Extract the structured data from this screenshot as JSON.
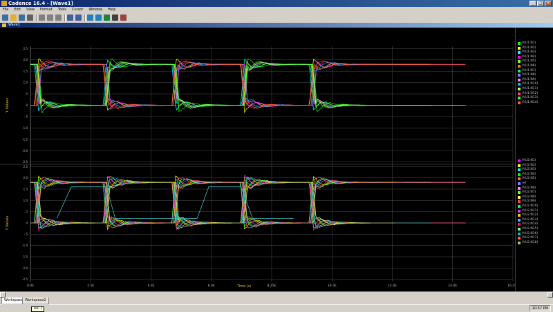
{
  "app": {
    "title": "Cadence 16.4 - [Wave1]"
  },
  "menu": [
    "File",
    "Edit",
    "View",
    "Format",
    "Tools",
    "Cursor",
    "Window",
    "Help"
  ],
  "child_window": {
    "title": "Wave1"
  },
  "tabs": [
    "Workspace1",
    "Workspace2"
  ],
  "status": {
    "tooltip": "Tab: 1",
    "time": "10:57 PM"
  },
  "colors": {
    "background": "#000000",
    "grid": "#505050"
  },
  "toolbar_icons": [
    "new-icon",
    "open-icon",
    "save-icon",
    "print-icon",
    "cut-icon",
    "copy-icon",
    "paste-icon",
    "undo-icon",
    "redo-icon",
    "zoom-in-icon",
    "zoom-out-icon",
    "fit-icon",
    "cursor-icon",
    "measure-icon"
  ],
  "chart_data": [
    {
      "type": "line",
      "title": "",
      "xlabel": "Time (s)",
      "ylabel": "Y Values",
      "xlim": [
        0,
        16.5
      ],
      "ylim": [
        -2.6,
        2.6
      ],
      "x_ticks": [
        "0.0E",
        "2.5E",
        "4.0E",
        "6.0E",
        "8.25E",
        "10.5E",
        "12.0E",
        "14.0E",
        "16.25E"
      ],
      "y_ticks": [
        "2.5",
        "2.0",
        "1.5",
        "1.0",
        ".5",
        "0",
        "-.5",
        "-1.0",
        "-1.5",
        "-2.0",
        "-2.5"
      ],
      "transitions": [
        0.2,
        2.55,
        4.9,
        7.25,
        9.6
      ],
      "levels": {
        "high": 1.8,
        "low": 0.0,
        "overshoot": 2.1,
        "undershoot": -0.3
      },
      "series_count": 14
    },
    {
      "type": "line",
      "title": "",
      "xlabel": "Time (s)",
      "ylabel": "Y Values",
      "xlim": [
        0,
        16.5
      ],
      "ylim": [
        -2.6,
        2.6
      ],
      "x_ticks": [
        "0.0E",
        "2.5E",
        "4.0E",
        "6.0E",
        "8.25E",
        "10.5E",
        "12.0E",
        "14.0E",
        "16.25E"
      ],
      "y_ticks": [
        "2.5",
        "2.0",
        "1.5",
        "1.0",
        ".5",
        "0",
        "-.5",
        "-1.0",
        "-1.5",
        "-2.0",
        "-2.5"
      ],
      "transitions": [
        0.2,
        2.55,
        4.9,
        7.25,
        9.6
      ],
      "levels": {
        "high": 1.8,
        "low": 0.0,
        "overshoot": 2.1,
        "undershoot": -0.3
      },
      "series_count": 19
    }
  ],
  "legend_top": [
    {
      "label": "V(U1.N1)",
      "color": "#00ff00"
    },
    {
      "label": "V(U1.N2)",
      "color": "#ffff00"
    },
    {
      "label": "V(U1.N3)",
      "color": "#00ffff"
    },
    {
      "label": "V(U1.N4)",
      "color": "#ff00ff"
    },
    {
      "label": "V(U1.N5)",
      "color": "#80ff00"
    },
    {
      "label": "V(U1.N6)",
      "color": "#ff8000"
    },
    {
      "label": "V(U1.N7)",
      "color": "#00ff80"
    },
    {
      "label": "V(U1.N8)",
      "color": "#8080ff"
    },
    {
      "label": "V(U1.N9)",
      "color": "#ff80ff"
    },
    {
      "label": "V(U1.N10)",
      "color": "#00c0ff"
    },
    {
      "label": "V(U1.N11)",
      "color": "#c0ff40"
    },
    {
      "label": "V(U1.N12)",
      "color": "#ff4080"
    },
    {
      "label": "V(U1.N13)",
      "color": "#40ff40"
    },
    {
      "label": "V(U1.N14)",
      "color": "#ff6020"
    }
  ],
  "legend_bottom": [
    {
      "label": "V(U2.N1)",
      "color": "#ff00ff"
    },
    {
      "label": "V(U2.N2)",
      "color": "#ffff00"
    },
    {
      "label": "V(U2.N3)",
      "color": "#00ffff"
    },
    {
      "label": "V(U2.N4)",
      "color": "#00ff00"
    },
    {
      "label": "V(U2.N5)",
      "color": "#ff8000"
    },
    {
      "label": "ref",
      "color": "#8080ff"
    },
    {
      "label": "V(U2.N6)",
      "color": "#ff80ff"
    },
    {
      "label": "V(U2.N7)",
      "color": "#80ff00"
    },
    {
      "label": "V(U2.N8)",
      "color": "#ffff80"
    },
    {
      "label": "V(U2.N9)",
      "color": "#ff4040"
    },
    {
      "label": "V(U2.N10)",
      "color": "#00ff80"
    },
    {
      "label": "V(U2.N11)",
      "color": "#c040ff"
    },
    {
      "label": "V(U2.N12)",
      "color": "#ffc000"
    },
    {
      "label": "V(U2.N13)",
      "color": "#40c0ff"
    },
    {
      "label": "V(U2.N14)",
      "color": "#ff0080"
    },
    {
      "label": "V(U2.N15)",
      "color": "#80ff80"
    },
    {
      "label": "V(U2.N16)",
      "color": "#00c0c0"
    },
    {
      "label": "V(U2.N17)",
      "color": "#ff6060"
    },
    {
      "label": "V(U2.N18)",
      "color": "#c0c040"
    }
  ]
}
